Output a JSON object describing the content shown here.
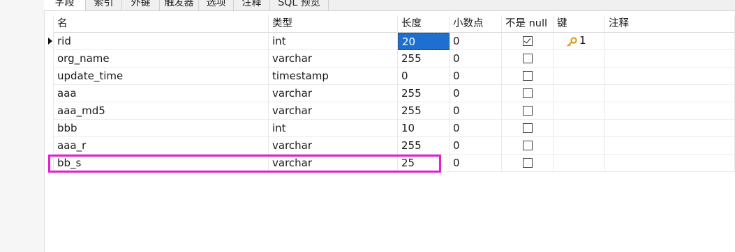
{
  "tabs": [
    {
      "label": "字段",
      "active": true
    },
    {
      "label": "索引",
      "active": false
    },
    {
      "label": "外键",
      "active": false
    },
    {
      "label": "触发器",
      "active": false
    },
    {
      "label": "选项",
      "active": false
    },
    {
      "label": "注释",
      "active": false
    },
    {
      "label": "SQL 预览",
      "active": false
    }
  ],
  "columns": {
    "name": "名",
    "type": "类型",
    "length": "长度",
    "decimals": "小数点",
    "not_null": "不是 null",
    "key": "键",
    "comment": "注释"
  },
  "rows": [
    {
      "name": "rid",
      "type": "int",
      "length": "20",
      "decimals": "0",
      "not_null": true,
      "key": "1",
      "comment": ""
    },
    {
      "name": "org_name",
      "type": "varchar",
      "length": "255",
      "decimals": "0",
      "not_null": false,
      "key": "",
      "comment": ""
    },
    {
      "name": "update_time",
      "type": "timestamp",
      "length": "0",
      "decimals": "0",
      "not_null": false,
      "key": "",
      "comment": ""
    },
    {
      "name": "aaa",
      "type": "varchar",
      "length": "255",
      "decimals": "0",
      "not_null": false,
      "key": "",
      "comment": ""
    },
    {
      "name": "aaa_md5",
      "type": "varchar",
      "length": "255",
      "decimals": "0",
      "not_null": false,
      "key": "",
      "comment": ""
    },
    {
      "name": "bbb",
      "type": "int",
      "length": "10",
      "decimals": "0",
      "not_null": false,
      "key": "",
      "comment": ""
    },
    {
      "name": "aaa_r",
      "type": "varchar",
      "length": "255",
      "decimals": "0",
      "not_null": false,
      "key": "",
      "comment": ""
    },
    {
      "name": "bb_s",
      "type": "varchar",
      "length": "25",
      "decimals": "0",
      "not_null": false,
      "key": "",
      "comment": ""
    }
  ],
  "selection": {
    "current_row": 0,
    "selected_cell": "length"
  },
  "colors": {
    "highlight": "#e81ad6",
    "selection": "#1e6fd0",
    "key_icon": "#d9a020"
  },
  "icons": {
    "primary_key": "key-icon",
    "current_row": "row-pointer-icon"
  }
}
